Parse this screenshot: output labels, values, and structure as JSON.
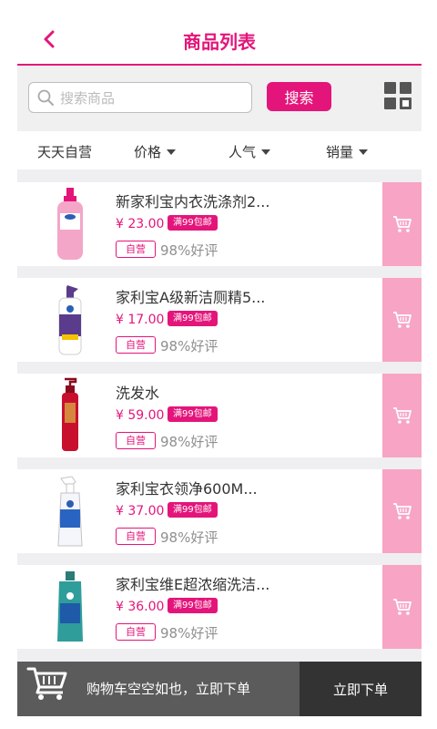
{
  "header": {
    "title": "商品列表",
    "back_icon": "chevron-left-icon"
  },
  "search": {
    "placeholder": "搜索商品",
    "button_label": "搜索",
    "view_toggle_icon": "grid-view-icon"
  },
  "filters": [
    {
      "label": "天天自营",
      "has_caret": false
    },
    {
      "label": "价格",
      "has_caret": true
    },
    {
      "label": "人气",
      "has_caret": true
    },
    {
      "label": "销量",
      "has_caret": true
    }
  ],
  "products": [
    {
      "name": "新家利宝内衣洗涤剂2...",
      "price": "¥ 23.00",
      "shipping_tag": "满99包邮",
      "self_tag": "自营",
      "rating": "98%好评",
      "bottle_color": "#f3a6c8",
      "cap_color": "#e4157a"
    },
    {
      "name": "家利宝A级新洁厕精5...",
      "price": "¥ 17.00",
      "shipping_tag": "满99包邮",
      "self_tag": "自营",
      "rating": "98%好评",
      "bottle_color": "#ffffff",
      "cap_color": "#5a3b8c"
    },
    {
      "name": "洗发水",
      "price": "¥ 59.00",
      "shipping_tag": "满99包邮",
      "self_tag": "自营",
      "rating": "98%好评",
      "bottle_color": "#c8102e",
      "cap_color": "#8a0a1e"
    },
    {
      "name": "家利宝衣领净600M...",
      "price": "¥ 37.00",
      "shipping_tag": "满99包邮",
      "self_tag": "自营",
      "rating": "98%好评",
      "bottle_color": "#f4f6fb",
      "cap_color": "#2a64c2"
    },
    {
      "name": "家利宝维E超浓缩洗洁...",
      "price": "¥ 36.00",
      "shipping_tag": "满99包邮",
      "self_tag": "自营",
      "rating": "98%好评",
      "bottle_color": "#2f9d9a",
      "cap_color": "#2b7c78"
    }
  ],
  "cart": {
    "empty_text": "购物车空空如也，立即下单",
    "order_button_label": "立即下单",
    "cart_icon": "shopping-cart-icon"
  },
  "colors": {
    "accent": "#e4157a",
    "cart_side": "#f7a4c5",
    "bottom_dark": "#333333",
    "bottom_gray": "#5b5b5b"
  }
}
